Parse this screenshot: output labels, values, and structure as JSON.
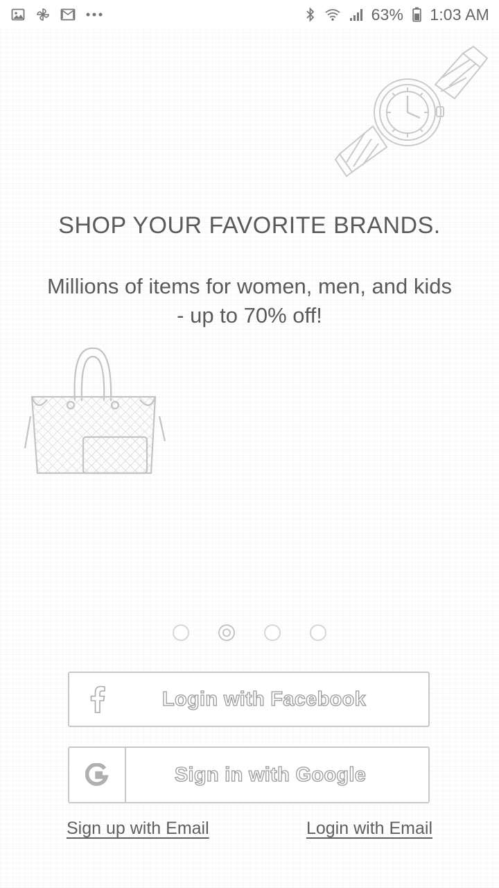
{
  "status_bar": {
    "left_icons": [
      "image-icon",
      "pinwheel-icon",
      "mail-icon",
      "more-dots-icon"
    ],
    "right_icons": [
      "bluetooth-icon",
      "wifi-icon",
      "signal-icon"
    ],
    "battery_percent": "63%",
    "time": "1:03 AM"
  },
  "onboarding": {
    "headline": "SHOP YOUR FAVORITE BRANDS.",
    "subtitle": "Millions of items for women, men, and kids - up to 70% off!",
    "illustrations": [
      "watch-illustration",
      "handbag-illustration"
    ]
  },
  "pager": {
    "page_count": 4,
    "active_index": 1
  },
  "actions": {
    "facebook_label": "Login with Facebook",
    "google_label": "Sign in with Google",
    "signup_email_label": "Sign up with Email",
    "login_email_label": "Login with Email"
  },
  "colors": {
    "button_border": "#c7c7c7",
    "text": "#5a5a5a"
  }
}
